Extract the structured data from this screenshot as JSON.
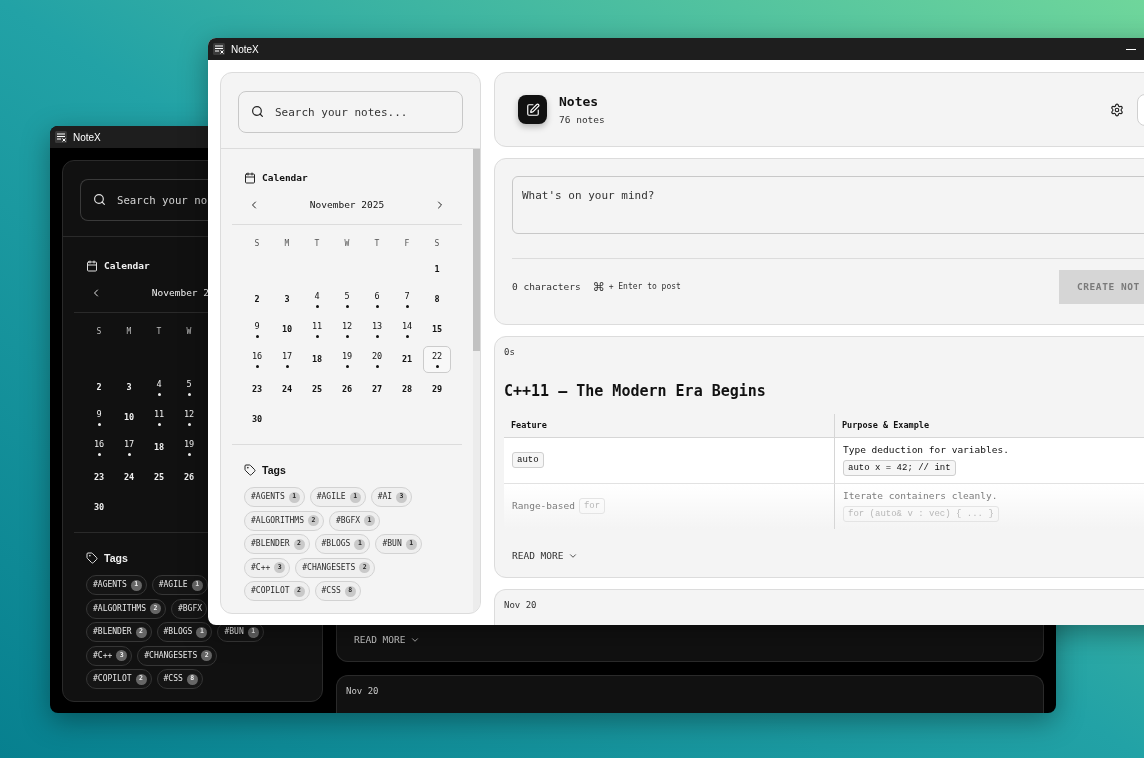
{
  "desktop": {
    "windows": [
      {
        "dark_mode": true,
        "title": "NoteX",
        "sidebar": {
          "search": {
            "placeholder": "Search your no"
          },
          "calendar": {
            "heading": "Calendar",
            "month": "November 2",
            "weekdays": [
              "S",
              "M",
              "T",
              "W"
            ],
            "weeks": [
              {
                "right_aligned": false,
                "days": [
                  {
                    "day": "2",
                    "has_notes": false,
                    "selected": false
                  },
                  {
                    "day": "3",
                    "has_notes": false,
                    "selected": false
                  },
                  {
                    "day": "4",
                    "has_notes": true,
                    "selected": false
                  },
                  {
                    "day": "5",
                    "has_notes": true,
                    "selected": false
                  }
                ]
              },
              {
                "right_aligned": false,
                "days": [
                  {
                    "day": "9",
                    "has_notes": true,
                    "selected": false
                  },
                  {
                    "day": "10",
                    "has_notes": false,
                    "selected": false
                  },
                  {
                    "day": "11",
                    "has_notes": true,
                    "selected": false
                  },
                  {
                    "day": "12",
                    "has_notes": true,
                    "selected": false
                  }
                ]
              },
              {
                "right_aligned": false,
                "days": [
                  {
                    "day": "16",
                    "has_notes": true,
                    "selected": false
                  },
                  {
                    "day": "17",
                    "has_notes": true,
                    "selected": false
                  },
                  {
                    "day": "18",
                    "has_notes": false,
                    "selected": false
                  },
                  {
                    "day": "19",
                    "has_notes": true,
                    "selected": false
                  }
                ]
              },
              {
                "right_aligned": false,
                "days": [
                  {
                    "day": "23",
                    "has_notes": false,
                    "selected": false
                  },
                  {
                    "day": "24",
                    "has_notes": false,
                    "selected": false
                  },
                  {
                    "day": "25",
                    "has_notes": false,
                    "selected": false
                  },
                  {
                    "day": "26",
                    "has_notes": false,
                    "selected": false
                  }
                ]
              },
              {
                "right_aligned": false,
                "days": [
                  {
                    "day": "30",
                    "has_notes": false,
                    "selected": false
                  }
                ]
              }
            ]
          },
          "tags": {
            "heading": "Tags",
            "rows": [
              [
                {
                  "name": "#AGENTS",
                  "count": "1"
                },
                {
                  "name": "#AGILE",
                  "count": "1"
                }
              ],
              [
                {
                  "name": "#ALGORITHMS",
                  "count": "2"
                },
                {
                  "name": "#BGFX"
                }
              ],
              [
                {
                  "name": "#BLENDER",
                  "count": "2"
                },
                {
                  "name": "#BLOGS",
                  "count": "1"
                },
                {
                  "name": "#BUN",
                  "count": "1"
                }
              ],
              [
                {
                  "name": "#C++",
                  "count": "3"
                },
                {
                  "name": "#CHANGESETS",
                  "count": "2"
                }
              ],
              [
                {
                  "name": "#COPILOT",
                  "count": "2"
                },
                {
                  "name": "#CSS",
                  "count": "8"
                }
              ]
            ]
          }
        },
        "notes": [
          {
            "read_more": "READ MORE",
            "expanded": false
          },
          {
            "time": "Nov 20"
          }
        ]
      },
      {
        "dark_mode": false,
        "title": "NoteX",
        "sidebar": {
          "search": {
            "placeholder": "Search your notes..."
          },
          "calendar": {
            "heading": "Calendar",
            "month": "November 2025",
            "weekdays": [
              "S",
              "M",
              "T",
              "W",
              "T",
              "F",
              "S"
            ],
            "weeks": [
              {
                "right_aligned": true,
                "days": [
                  {
                    "day": "1",
                    "has_notes": false,
                    "selected": false
                  }
                ]
              },
              {
                "days": [
                  {
                    "day": "2",
                    "has_notes": false,
                    "selected": false
                  },
                  {
                    "day": "3",
                    "has_notes": false,
                    "selected": false
                  },
                  {
                    "day": "4",
                    "has_notes": true,
                    "selected": false
                  },
                  {
                    "day": "5",
                    "has_notes": true,
                    "selected": false
                  },
                  {
                    "day": "6",
                    "has_notes": true,
                    "selected": false
                  },
                  {
                    "day": "7",
                    "has_notes": true,
                    "selected": false
                  },
                  {
                    "day": "8",
                    "has_notes": false,
                    "selected": false
                  }
                ]
              },
              {
                "days": [
                  {
                    "day": "9",
                    "has_notes": true,
                    "selected": false
                  },
                  {
                    "day": "10",
                    "has_notes": false,
                    "selected": false
                  },
                  {
                    "day": "11",
                    "has_notes": true,
                    "selected": false
                  },
                  {
                    "day": "12",
                    "has_notes": true,
                    "selected": false
                  },
                  {
                    "day": "13",
                    "has_notes": true,
                    "selected": false
                  },
                  {
                    "day": "14",
                    "has_notes": true,
                    "selected": false
                  },
                  {
                    "day": "15",
                    "has_notes": false,
                    "selected": false
                  }
                ]
              },
              {
                "days": [
                  {
                    "day": "16",
                    "has_notes": true,
                    "selected": false
                  },
                  {
                    "day": "17",
                    "has_notes": true,
                    "selected": false
                  },
                  {
                    "day": "18",
                    "has_notes": false,
                    "selected": false
                  },
                  {
                    "day": "19",
                    "has_notes": true,
                    "selected": false
                  },
                  {
                    "day": "20",
                    "has_notes": true,
                    "selected": false
                  },
                  {
                    "day": "21",
                    "has_notes": false,
                    "selected": false
                  },
                  {
                    "day": "22",
                    "has_notes": true,
                    "selected": true
                  }
                ]
              },
              {
                "days": [
                  {
                    "day": "23",
                    "has_notes": false,
                    "selected": false
                  },
                  {
                    "day": "24",
                    "has_notes": false,
                    "selected": false
                  },
                  {
                    "day": "25",
                    "has_notes": false,
                    "selected": false
                  },
                  {
                    "day": "26",
                    "has_notes": false,
                    "selected": false
                  },
                  {
                    "day": "27",
                    "has_notes": false,
                    "selected": false
                  },
                  {
                    "day": "28",
                    "has_notes": false,
                    "selected": false
                  },
                  {
                    "day": "29",
                    "has_notes": false,
                    "selected": false
                  }
                ]
              },
              {
                "right_aligned": false,
                "days": [
                  {
                    "day": "30",
                    "has_notes": false,
                    "selected": false
                  }
                ]
              }
            ]
          },
          "tags": {
            "heading": "Tags",
            "rows": [
              [
                {
                  "name": "#AGENTS",
                  "count": "1"
                },
                {
                  "name": "#AGILE",
                  "count": "1"
                },
                {
                  "name": "#AI",
                  "count": "3"
                }
              ],
              [
                {
                  "name": "#ALGORITHMS",
                  "count": "2"
                },
                {
                  "name": "#BGFX",
                  "count": "1"
                }
              ],
              [
                {
                  "name": "#BLENDER",
                  "count": "2"
                },
                {
                  "name": "#BLOGS",
                  "count": "1"
                },
                {
                  "name": "#BUN",
                  "count": "1"
                }
              ],
              [
                {
                  "name": "#C++",
                  "count": "3"
                },
                {
                  "name": "#CHANGESETS",
                  "count": "2"
                }
              ],
              [
                {
                  "name": "#COPILOT",
                  "count": "2"
                },
                {
                  "name": "#CSS",
                  "count": "8"
                }
              ]
            ]
          }
        },
        "header": {
          "title": "Notes",
          "subtitle": "76 notes"
        },
        "composer": {
          "placeholder": "What's on your mind?",
          "char_count": "0 characters",
          "shortcut_key": "⌘",
          "shortcut_hint": "+ Enter to post",
          "button": {
            "label": "CREATE NOT",
            "disabled": true
          }
        },
        "notes": [
          {
            "time": "0s",
            "title": "C++11 – The Modern Era Begins",
            "table": {
              "columns": [
                "Feature",
                "Purpose & Example"
              ],
              "rows": [
                {
                  "cells": [
                    [
                      [
                        {
                          "kind": "code",
                          "text": "auto"
                        }
                      ]
                    ],
                    [
                      [
                        {
                          "kind": "text",
                          "text": "Type deduction for variables."
                        }
                      ],
                      [
                        {
                          "kind": "code",
                          "text": "auto x = 42; // int"
                        }
                      ]
                    ]
                  ]
                },
                {
                  "cells": [
                    [
                      [
                        {
                          "kind": "text",
                          "text": "Range-based"
                        },
                        {
                          "kind": "code",
                          "text": "for"
                        }
                      ]
                    ],
                    [
                      [
                        {
                          "kind": "text",
                          "text": "Iterate containers cleanly."
                        }
                      ],
                      [
                        {
                          "kind": "code",
                          "text": "for (auto& v : vec) { ... }"
                        }
                      ]
                    ]
                  ]
                }
              ]
            },
            "read_more": "READ MORE",
            "expanded": false
          },
          {
            "time": "Nov 20"
          }
        ]
      }
    ]
  }
}
